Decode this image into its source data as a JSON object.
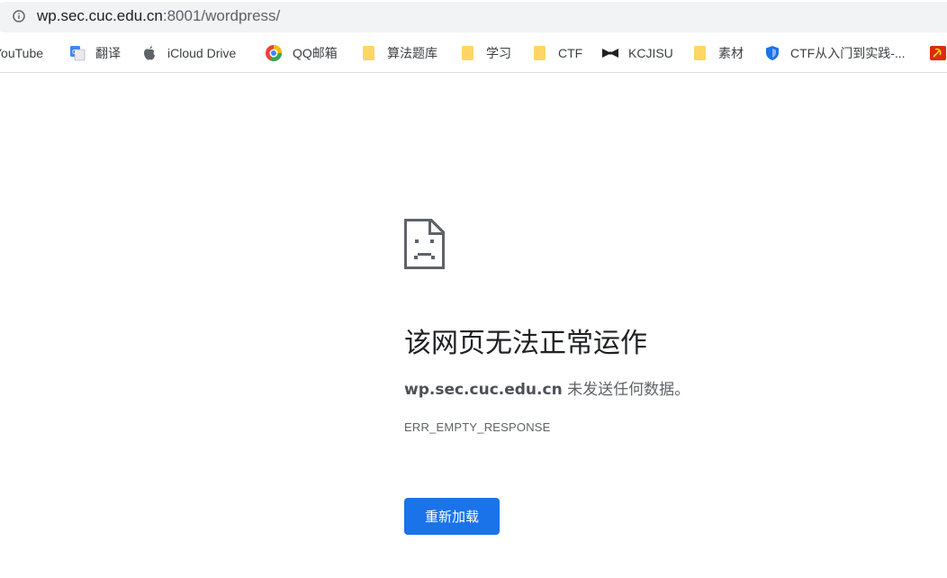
{
  "address_bar": {
    "url_host": "wp.sec.cuc.edu.cn",
    "url_rest": ":8001/wordpress/"
  },
  "bookmarks": [
    {
      "label": "YouTube",
      "icon": "youtube-icon"
    },
    {
      "label": "翻译",
      "icon": "translate-icon"
    },
    {
      "label": "iCloud Drive",
      "icon": "apple-icon"
    },
    {
      "label": "QQ邮箱",
      "icon": "qq-mail-icon"
    },
    {
      "label": "算法题库",
      "icon": "folder-icon"
    },
    {
      "label": "学习",
      "icon": "folder-icon"
    },
    {
      "label": "CTF",
      "icon": "folder-icon"
    },
    {
      "label": "KCJISU",
      "icon": "bowtie-icon"
    },
    {
      "label": "素材",
      "icon": "folder-icon"
    },
    {
      "label": "CTF从入门到实践-...",
      "icon": "shield-icon"
    }
  ],
  "error": {
    "title": "该网页无法正常运作",
    "host": "wp.sec.cuc.edu.cn",
    "message_suffix": " 未发送任何数据。",
    "code": "ERR_EMPTY_RESPONSE",
    "reload_label": "重新加载"
  },
  "colors": {
    "accent": "#1a73e8",
    "folder": "#fdd663",
    "omnibox_bg": "#f1f3f4"
  }
}
